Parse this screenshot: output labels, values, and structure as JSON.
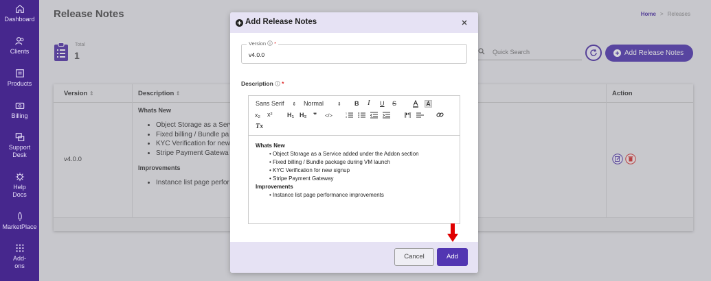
{
  "sidebar": {
    "items": [
      {
        "label": "Dashboard",
        "icon": "home-icon"
      },
      {
        "label": "Clients",
        "icon": "users-icon"
      },
      {
        "label": "Products",
        "icon": "box-icon"
      },
      {
        "label": "Billing",
        "icon": "billing-icon"
      },
      {
        "label": "Support Desk",
        "icon": "support-icon"
      },
      {
        "label": "Help Docs",
        "icon": "help-icon"
      },
      {
        "label": "MarketPlace",
        "icon": "rocket-icon"
      },
      {
        "label": "Add-ons",
        "icon": "grid-icon"
      }
    ],
    "color": "#46278d"
  },
  "page": {
    "title": "Release Notes",
    "breadcrumb": {
      "home": "Home",
      "separator": ">",
      "current": "Releases"
    },
    "total_label": "Total",
    "total_value": "1",
    "search_placeholder": "Quick Search",
    "add_button_label": "Add Release Notes"
  },
  "table": {
    "headers": {
      "version": "Version",
      "description": "Description",
      "action": "Action"
    },
    "rows": [
      {
        "version": "v4.0.0",
        "whats_new_heading": "Whats New",
        "whats_new_items": [
          "Object Storage as a Serv",
          "Fixed billing / Bundle pa",
          "KYC Verification for new",
          "Stripe Payment Gatewa"
        ],
        "improvements_heading": "Improvements",
        "improvements_items": [
          "Instance list page perfor"
        ]
      }
    ]
  },
  "modal": {
    "title": "Add Release Notes",
    "version_label": "Version",
    "required_mark": "*",
    "version_value": "v4.0.0",
    "description_label": "Description",
    "toolbar": {
      "font": "Sans Serif",
      "size": "Normal",
      "bold": "B",
      "italic": "I",
      "underline": "U",
      "strike": "S",
      "h1": "H₁",
      "h2": "H₂",
      "quote": "❞",
      "code": "</>",
      "subscript": "x₂",
      "superscript": "x²",
      "clear": "Tx"
    },
    "editor": {
      "whats_new_heading": "Whats New",
      "whats_new_items": [
        "• Object Storage as a Service added under the Addon section",
        "• Fixed billing / Bundle package during VM launch",
        "• KYC Verification for new signup",
        "• Stripe Payment Gateway"
      ],
      "improvements_heading": "Improvements",
      "improvements_items": [
        "• Instance list page performance improvements"
      ]
    },
    "cancel_label": "Cancel",
    "add_label": "Add"
  },
  "colors": {
    "accent": "#4f35b0",
    "arrow": "#e00000",
    "modal_header": "#e6e2f4"
  }
}
